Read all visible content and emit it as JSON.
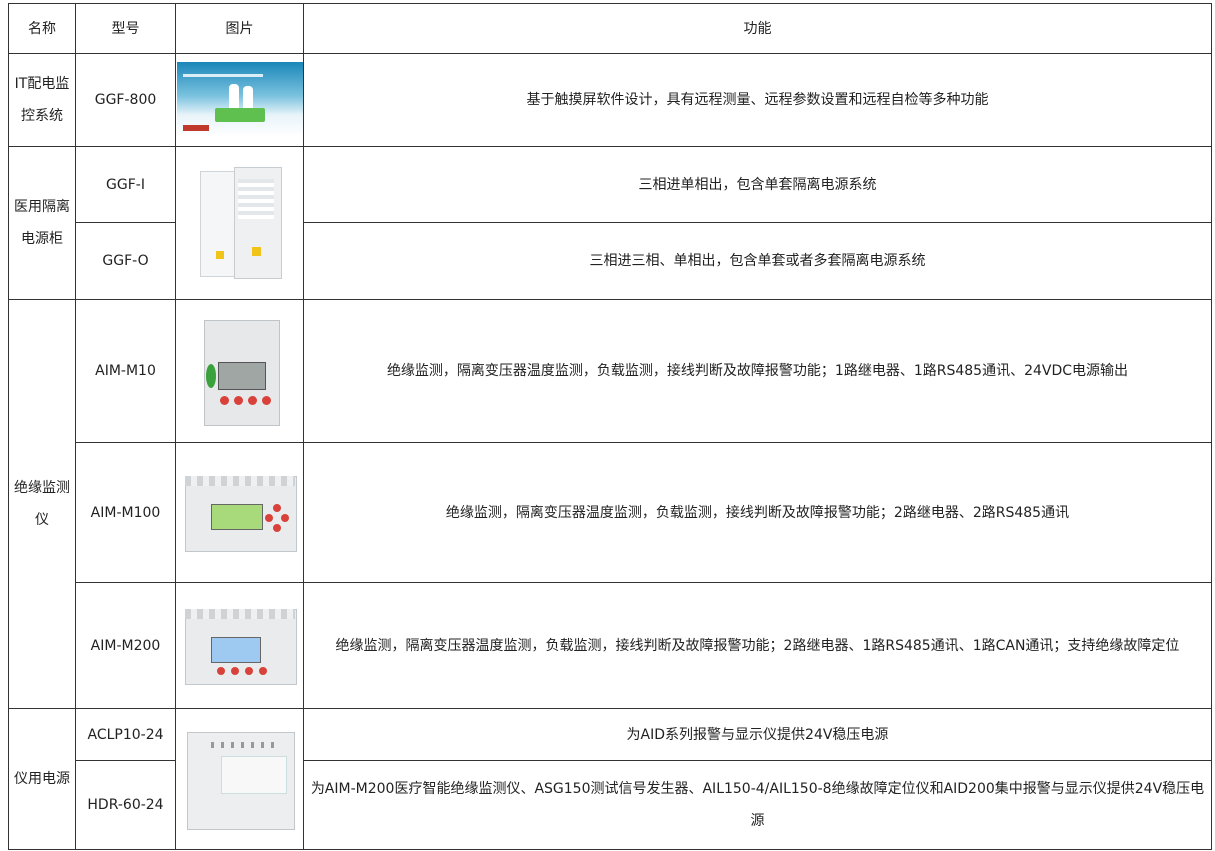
{
  "headers": {
    "name": "名称",
    "model": "型号",
    "image": "图片",
    "function": "功能"
  },
  "groups": [
    {
      "name": "IT配电监控系统",
      "models": [
        {
          "model": "GGF-800",
          "function": "基于触摸屏软件设计，具有远程测量、远程参数设置和远程自检等多种功能"
        }
      ]
    },
    {
      "name": "医用隔离电源柜",
      "models": [
        {
          "model": "GGF-I",
          "function": "三相进单相出，包含单套隔离电源系统"
        },
        {
          "model": "GGF-O",
          "function": "三相进三相、单相出，包含单套或者多套隔离电源系统"
        }
      ]
    },
    {
      "name": "绝缘监测仪",
      "models": [
        {
          "model": "AIM-M10",
          "function": "绝缘监测，隔离变压器温度监测，负载监测，接线判断及故障报警功能；1路继电器、1路RS485通讯、24VDC电源输出"
        },
        {
          "model": "AIM-M100",
          "function": "绝缘监测，隔离变压器温度监测，负载监测，接线判断及故障报警功能；2路继电器、2路RS485通讯"
        },
        {
          "model": "AIM-M200",
          "function": "绝缘监测，隔离变压器温度监测，负载监测，接线判断及故障报警功能；2路继电器、1路RS485通讯、1路CAN通讯；支持绝缘故障定位"
        }
      ]
    },
    {
      "name": "仪用电源",
      "models": [
        {
          "model": "ACLP10-24",
          "function": "为AID系列报警与显示仪提供24V稳压电源"
        },
        {
          "model": "HDR-60-24",
          "function": "为AIM-M200医疗智能绝缘监测仪、ASG150测试信号发生器、AIL150-4/AIL150-8绝缘故障定位仪和AID200集中报警与显示仪提供24V稳压电源"
        }
      ]
    }
  ],
  "icons": {
    "screen": "monitoring-screen-photo",
    "cabinet": "cabinet-photo",
    "meter": "meter-photo",
    "psu": "power-supply-photo"
  },
  "colors": {
    "border": "#333333",
    "text": "#222222"
  }
}
